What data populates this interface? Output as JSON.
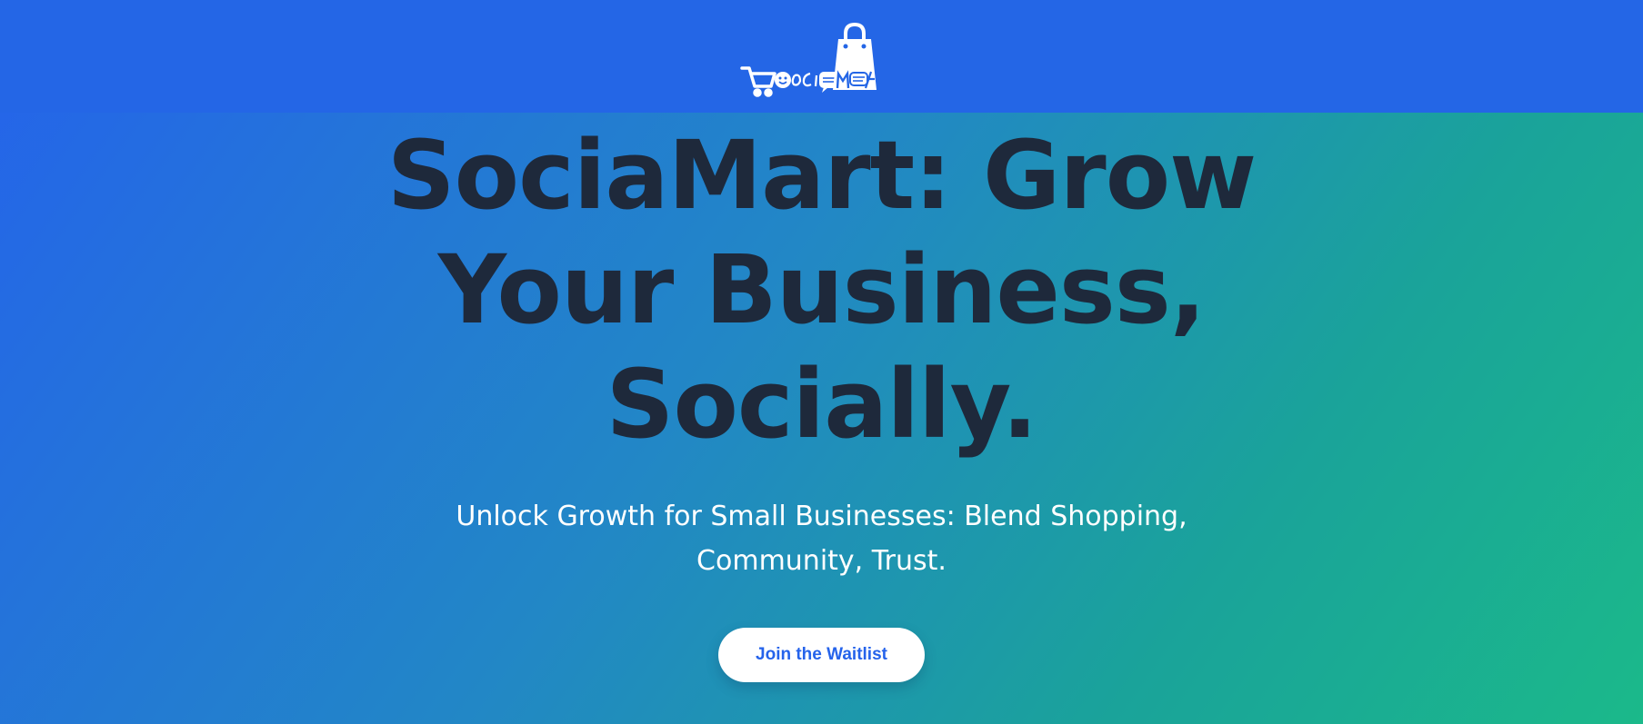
{
  "header": {
    "logo_icon": "sociamart-logo",
    "background": "#2466e6"
  },
  "hero": {
    "headline_line1": "SociaMart: Grow",
    "headline_line2": "Your Business,",
    "headline_line3": "Socially.",
    "subheadline_line1": "Unlock Growth for Small Businesses: Blend Shopping,",
    "subheadline_line2": "Community, Trust.",
    "cta_label": "Join the Waitlist"
  },
  "colors": {
    "gradient_start": "#2563eb",
    "gradient_end": "#1bb98a",
    "headline": "#1e293b",
    "cta_text": "#2563eb"
  }
}
